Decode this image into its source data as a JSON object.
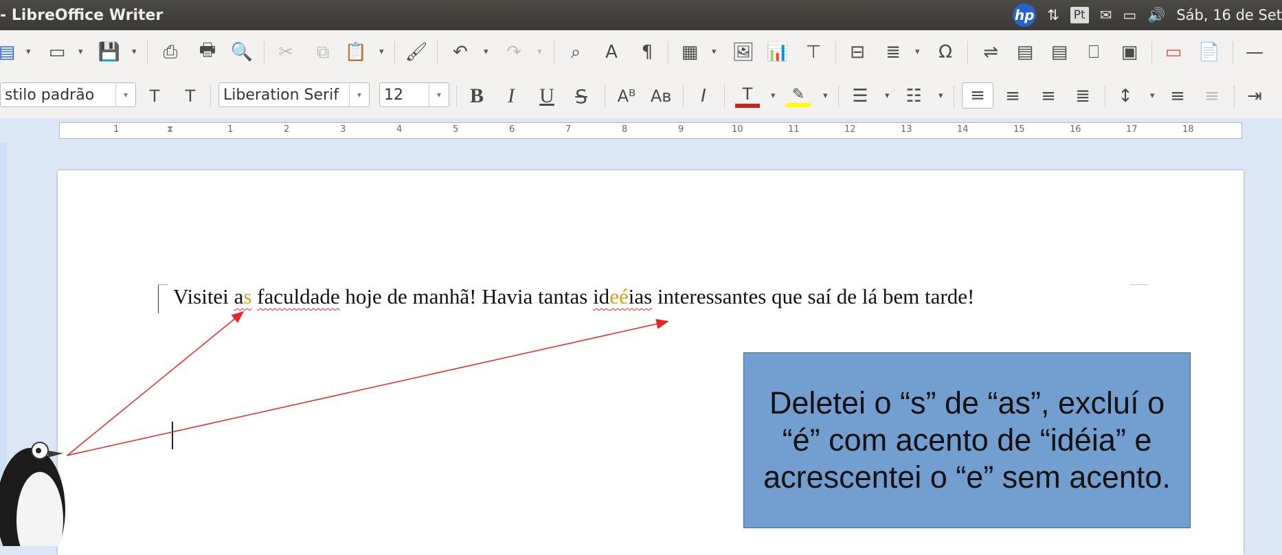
{
  "window": {
    "title": "- LibreOffice Writer"
  },
  "tray": {
    "keyboard": "Pt",
    "datetime": "Sáb, 16 de Set"
  },
  "format_bar": {
    "paragraph_style": "stilo padrão",
    "font_name": "Liberation Serif",
    "font_size": "12"
  },
  "ruler": {
    "numbers": [
      "1",
      "1",
      "2",
      "3",
      "4",
      "5",
      "6",
      "7",
      "8",
      "9",
      "10",
      "11",
      "12",
      "13",
      "14",
      "15",
      "16",
      "17",
      "18"
    ]
  },
  "document": {
    "part1": "Visitei ",
    "word_as_a": "a",
    "word_as_s": "s",
    "part2": " ",
    "word_faculdade": "faculdade",
    "part3": " hoje de manhã! Havia tantas ",
    "word_idea_1": "id",
    "word_idea_2": "eé",
    "word_idea_3": "ias",
    "part4": " interessantes que saí de lá bem tarde!"
  },
  "annotation": {
    "line1": "Deletei o “s” de “as”, excluí o",
    "line2": "“é” com acento de “idéia” e",
    "line3": "acrescentei o “e” sem acento."
  },
  "colors": {
    "arrow": "#ee2222",
    "callout_fill": "#729fcf",
    "font_color_bar": "#c9211e",
    "highlight_bar": "#ffff00"
  }
}
